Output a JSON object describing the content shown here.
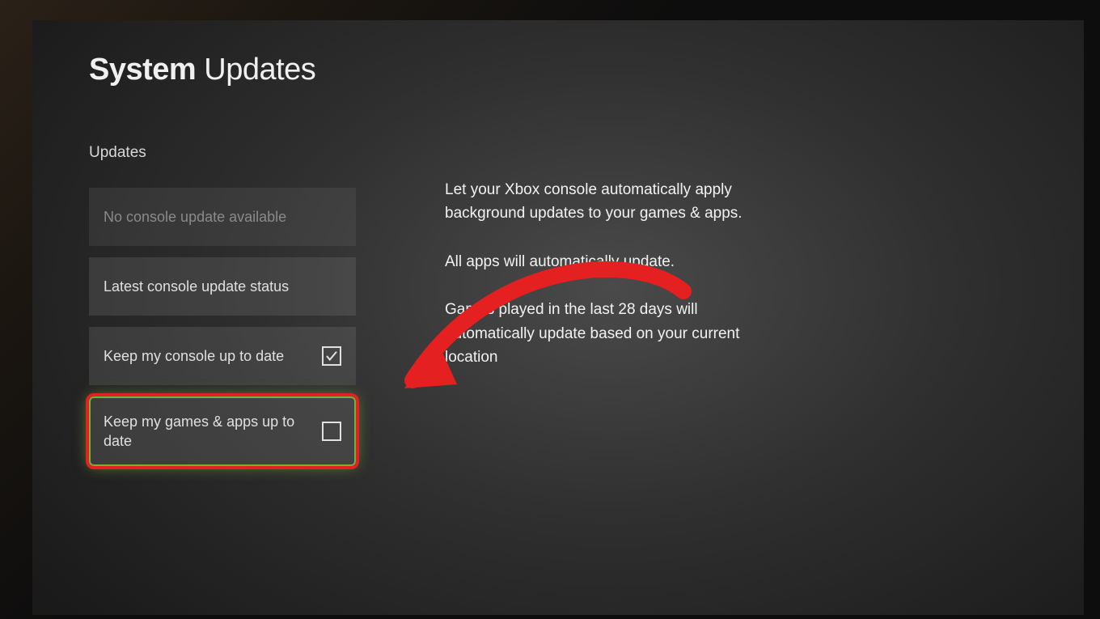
{
  "title": {
    "bold": "System",
    "rest": "Updates"
  },
  "section_label": "Updates",
  "tiles": {
    "no_update": "No console update available",
    "latest_status": "Latest console update status",
    "keep_console": "Keep my console up to date",
    "keep_games": "Keep my games & apps up to date"
  },
  "checkboxes": {
    "keep_console_checked": true,
    "keep_games_checked": false
  },
  "info": {
    "p1": "Let your Xbox console automatically apply background updates to your games & apps.",
    "p2": "All apps will automatically update.",
    "p3": "Games played in the last 28 days will automatically update based on your current location"
  },
  "annotation": {
    "color": "#e52020"
  }
}
